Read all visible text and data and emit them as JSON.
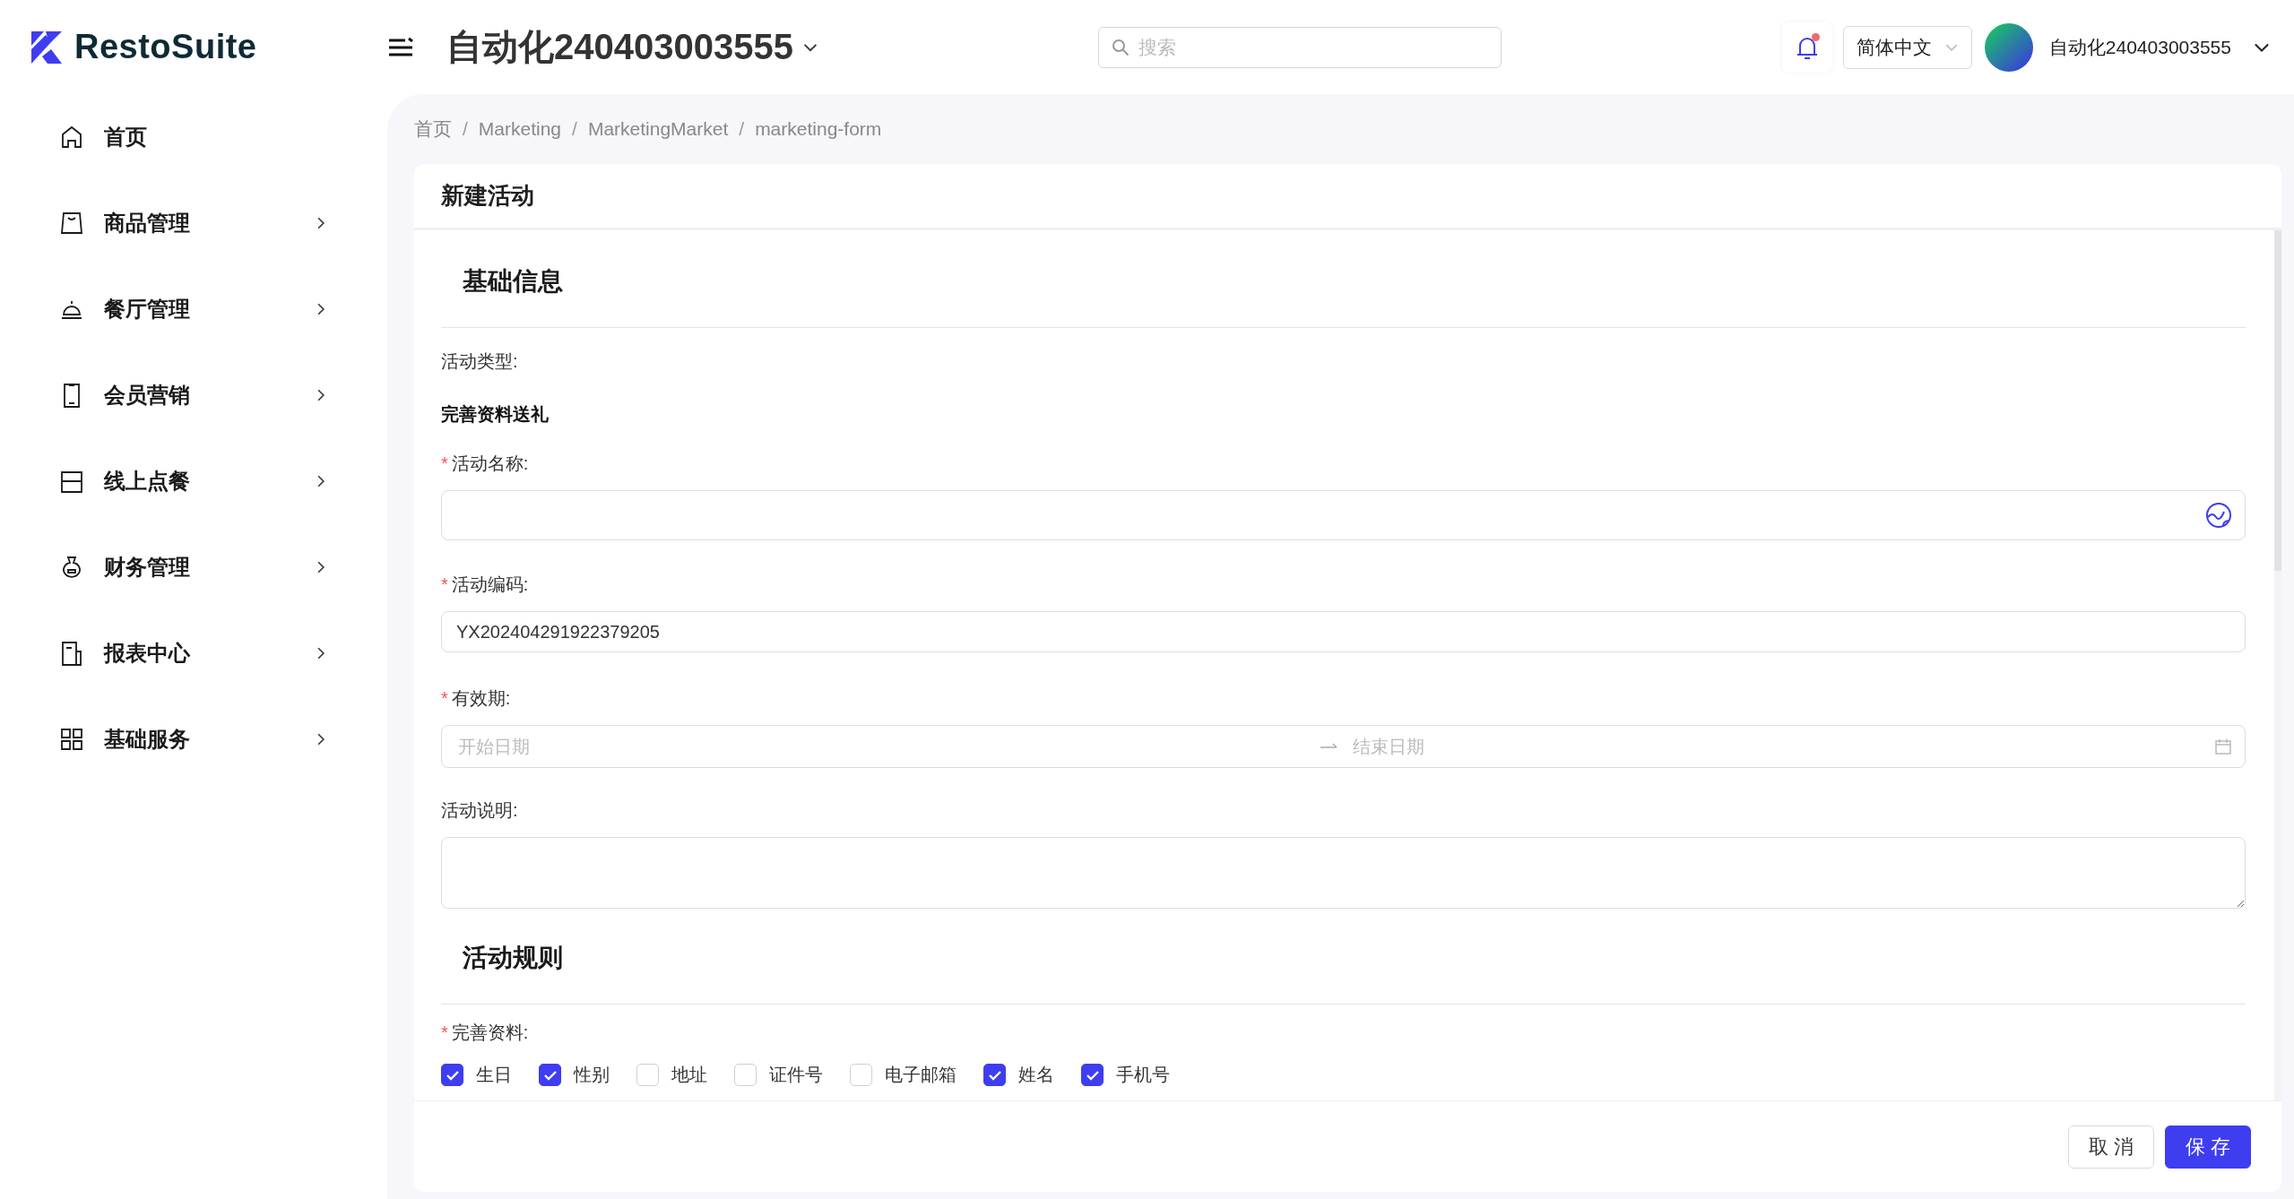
{
  "brand": {
    "name": "RestoSuite"
  },
  "header": {
    "store_name": "自动化240403003555",
    "search": {
      "placeholder": "搜索"
    },
    "unread": true,
    "language": "简体中文",
    "user_name": "自动化240403003555"
  },
  "sidebar": {
    "items": [
      {
        "label": "首页",
        "kind": "home",
        "expandable": false
      },
      {
        "label": "商品管理",
        "kind": "bag",
        "expandable": true
      },
      {
        "label": "餐厅管理",
        "kind": "bell",
        "expandable": true
      },
      {
        "label": "会员营销",
        "kind": "phone",
        "expandable": true
      },
      {
        "label": "线上点餐",
        "kind": "box",
        "expandable": true
      },
      {
        "label": "财务管理",
        "kind": "moneybag",
        "expandable": true
      },
      {
        "label": "报表中心",
        "kind": "report",
        "expandable": true
      },
      {
        "label": "基础服务",
        "kind": "grid",
        "expandable": true
      }
    ]
  },
  "breadcrumb": [
    {
      "label": "首页"
    },
    {
      "separator": "/",
      "label": "Marketing"
    },
    {
      "separator": "/",
      "label": "MarketingMarket"
    },
    {
      "separator": "/",
      "label": "marketing-form"
    }
  ],
  "form": {
    "title": "新建活动",
    "basic_section": {
      "title": "基础信息"
    },
    "activity_type": {
      "label": "活动类型:",
      "value": "完善资料送礼"
    },
    "name_field": {
      "required_mark": "*",
      "label": "活动名称:"
    },
    "code_field": {
      "required_mark": "*",
      "label": "活动编码:",
      "value": "YX202404291922379205"
    },
    "validity": {
      "required_mark": "*",
      "label": "有效期:",
      "start_placeholder": "开始日期",
      "end_placeholder": "结束日期"
    },
    "description": {
      "label": "活动说明:"
    },
    "rules_section": {
      "title": "活动规则"
    },
    "profile_fields": {
      "required_mark": "*",
      "label": "完善资料:",
      "options": [
        {
          "label": "生日",
          "checked": true
        },
        {
          "label": "性别",
          "checked": true
        },
        {
          "label": "地址",
          "checked": false
        },
        {
          "label": "证件号",
          "checked": false
        },
        {
          "label": "电子邮箱",
          "checked": false
        },
        {
          "label": "姓名",
          "checked": true
        },
        {
          "label": "手机号",
          "checked": true
        }
      ]
    }
  },
  "buttons": {
    "cancel": "取 消",
    "save": "保 存"
  }
}
